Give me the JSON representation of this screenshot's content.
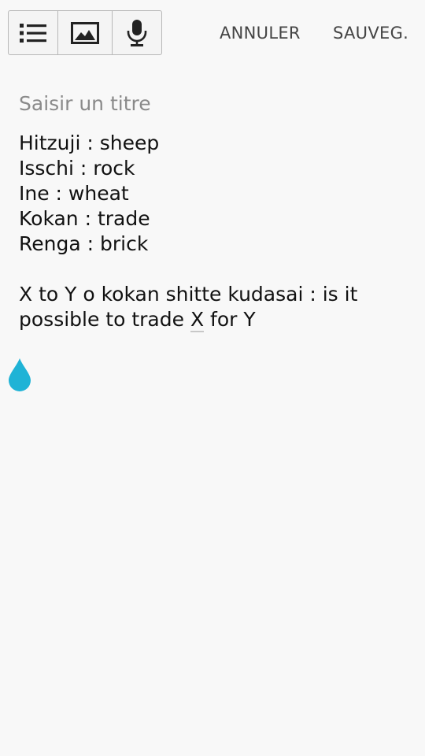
{
  "toolbar": {
    "icons": [
      "list-icon",
      "image-icon",
      "microphone-icon"
    ]
  },
  "actions": {
    "cancel_label": "ANNULER",
    "save_label": "SAUVEG."
  },
  "note": {
    "title_placeholder": "Saisir un titre",
    "lines": [
      "Hitzuji : sheep",
      "Isschi : rock",
      "Ine : wheat",
      "Kokan : trade",
      "Renga : brick"
    ],
    "sentence_prefix": "X to Y o kokan shitte kudasai : is it possible to trade ",
    "sentence_underlined": "X",
    "sentence_suffix": " for Y"
  },
  "colors": {
    "background": "#f8f8f8",
    "cursor_handle": "#1fb3d6",
    "placeholder": "#8a8a8a"
  }
}
